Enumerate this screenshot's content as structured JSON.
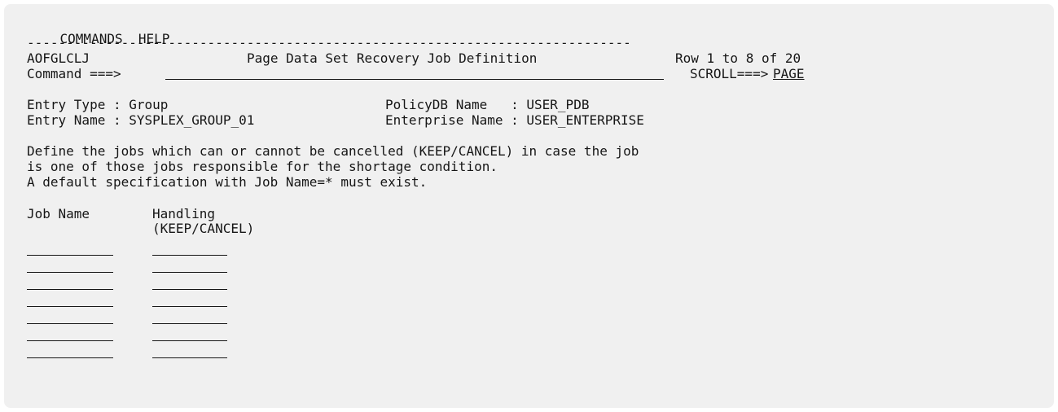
{
  "menu": {
    "commands": "COMMANDS",
    "help": "HELP"
  },
  "separator": "-----------------------------------------------------------------------------",
  "header": {
    "panel_id": "AOFGLCLJ",
    "title": "Page Data Set Recovery Job Definition",
    "row_info": "Row 1 to 8 of 20",
    "command_label": "Command ===>",
    "command_value": "",
    "scroll_label": "SCROLL===>",
    "scroll_value": "PAGE"
  },
  "entry": {
    "type_label": "Entry Type : ",
    "type_value": "Group",
    "name_label": "Entry Name : ",
    "name_value": "SYSPLEX_GROUP_01",
    "policydb_label": "PolicyDB Name   : ",
    "policydb_value": "USER_PDB",
    "enterprise_label": "Enterprise Name : ",
    "enterprise_value": "USER_ENTERPRISE"
  },
  "description": [
    "Define the jobs which can or cannot be cancelled (KEEP/CANCEL) in case the job",
    "is one of those jobs responsible for the shortage condition.",
    "A default specification with Job Name=* must exist."
  ],
  "table": {
    "col_job_name": "Job Name",
    "col_handling": "Handling",
    "col_handling_sub": "(KEEP/CANCEL)",
    "rows": [
      {
        "job_name": "",
        "handling": ""
      },
      {
        "job_name": "",
        "handling": ""
      },
      {
        "job_name": "",
        "handling": ""
      },
      {
        "job_name": "",
        "handling": ""
      },
      {
        "job_name": "",
        "handling": ""
      },
      {
        "job_name": "",
        "handling": ""
      },
      {
        "job_name": "",
        "handling": ""
      }
    ]
  }
}
